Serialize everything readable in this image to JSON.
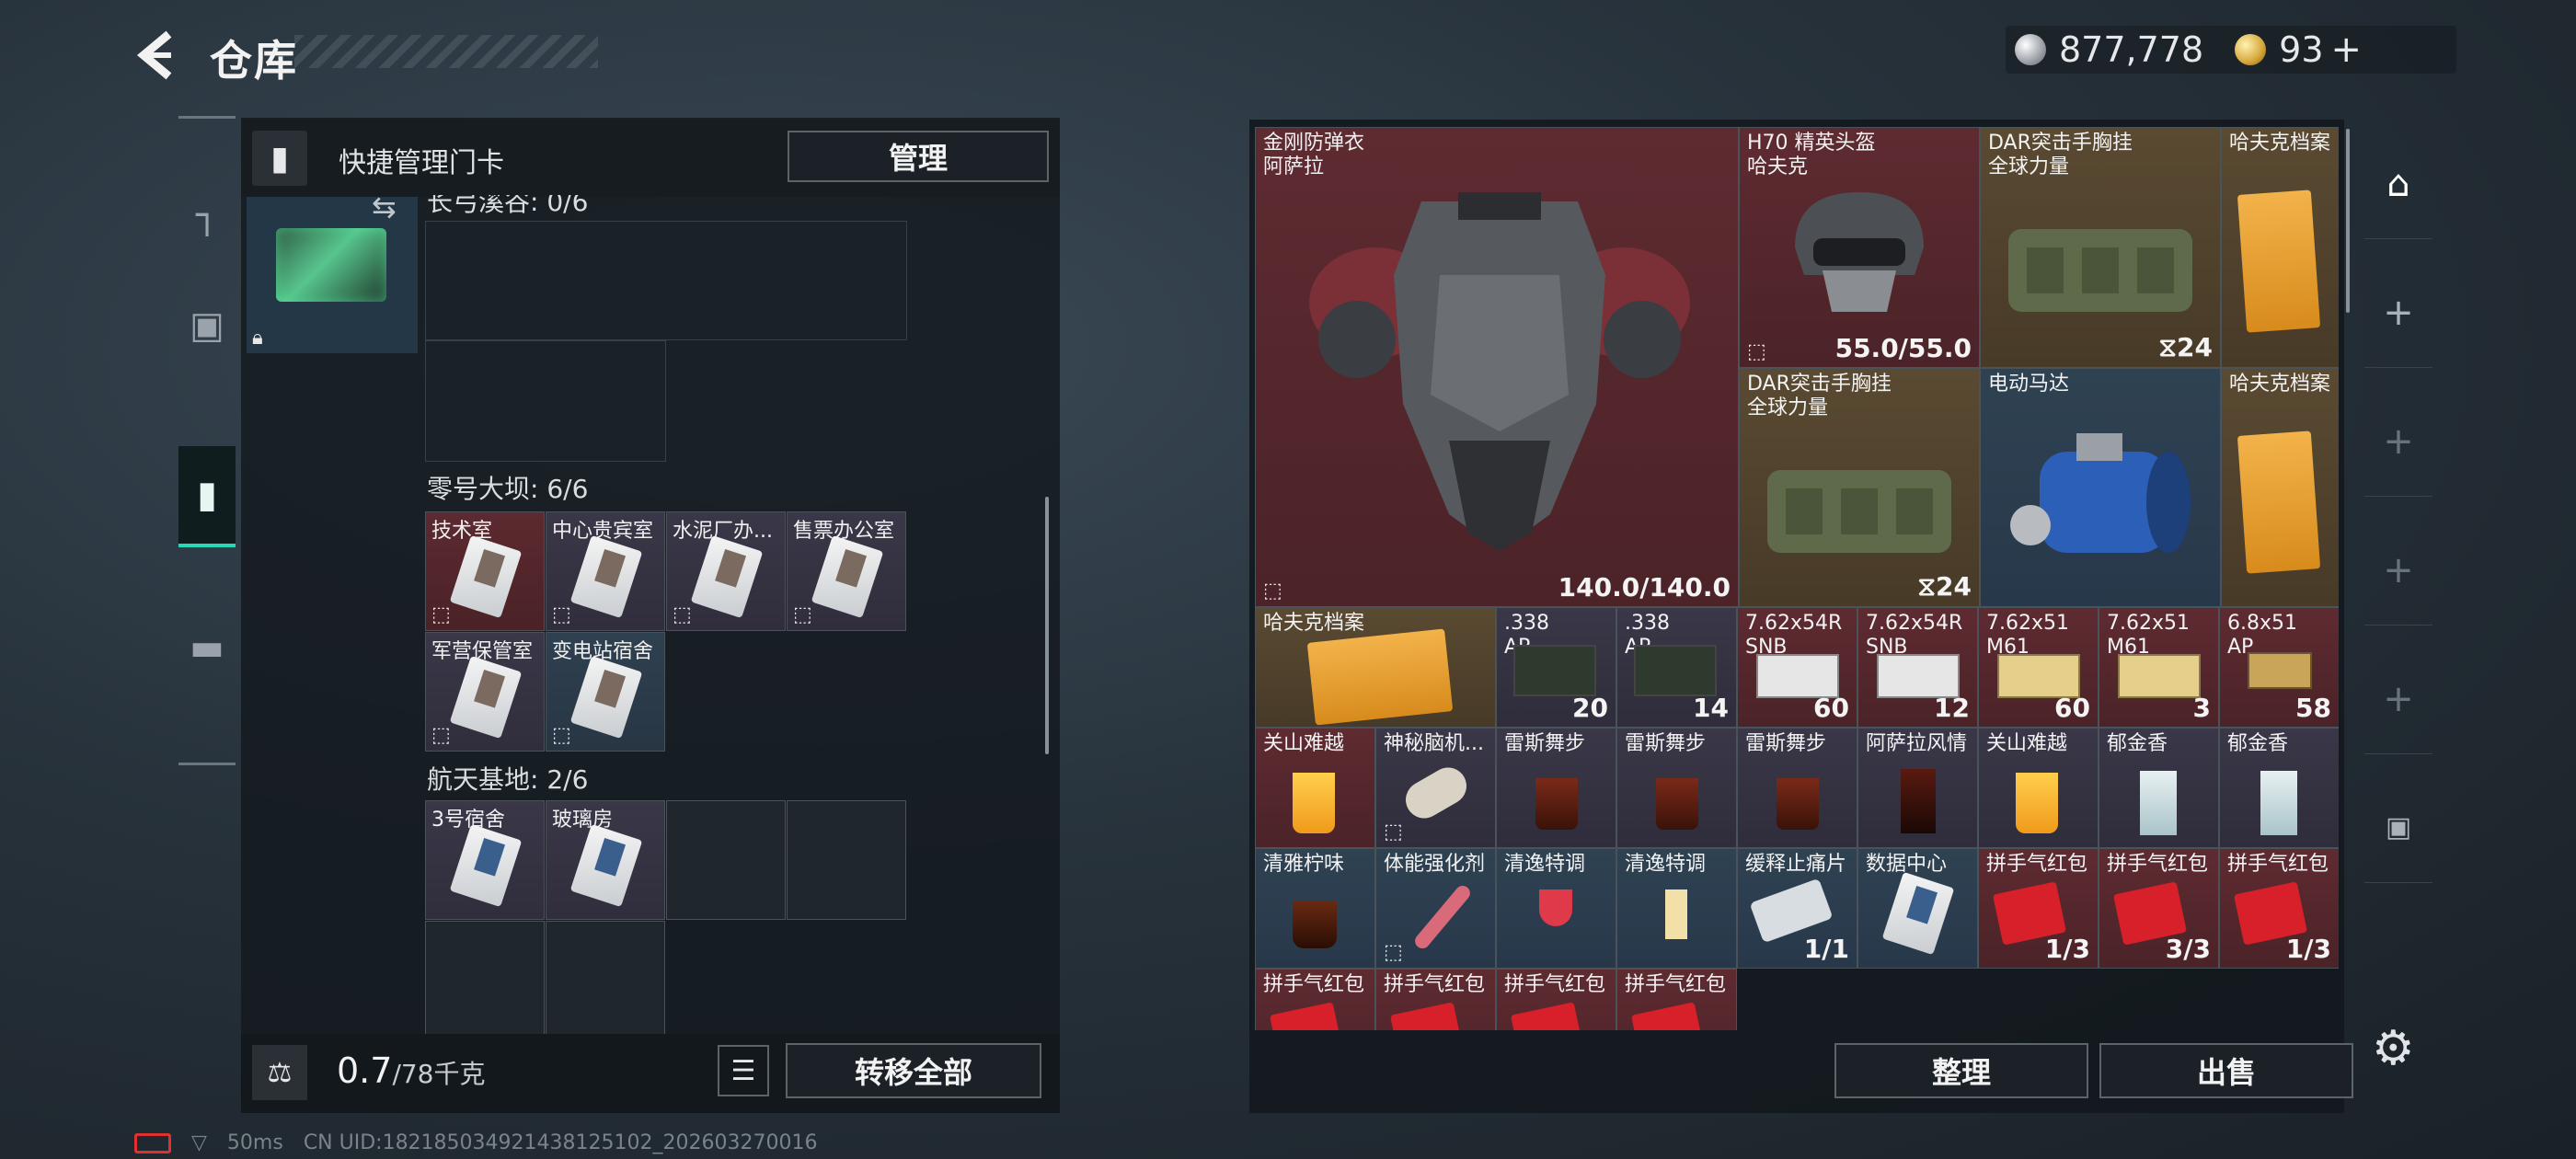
{
  "header": {
    "title": "仓库"
  },
  "currency": {
    "silver": "877,778",
    "gold": "93",
    "gold_plus": "+"
  },
  "left_nav": {
    "items": [
      "weapon",
      "armor",
      "keycard",
      "case"
    ],
    "active": "keycard"
  },
  "keycard_panel": {
    "title": "快捷管理门卡",
    "manage_label": "管理",
    "sections": [
      {
        "name": "长弓溪谷: 0/6",
        "cards": []
      },
      {
        "name": "零号大坝: 6/6",
        "cards": [
          "技术室",
          "中心贵宾室",
          "水泥厂办...",
          "售票办公室",
          "军营保管室",
          "变电站宿舍"
        ]
      },
      {
        "name": "航天基地: 2/6",
        "cards": [
          "3号宿舍",
          "玻璃房"
        ]
      }
    ]
  },
  "weight": {
    "value": "0.7",
    "capacity": "/78千克"
  },
  "transfer_label": "转移全部",
  "inventory": {
    "items": [
      {
        "name": "金刚防弹衣\n阿萨拉",
        "qty": "140.0/140.0"
      },
      {
        "name": "H70 精英头盔\n哈夫克",
        "qty": "55.0/55.0"
      },
      {
        "name": "DAR突击手胸挂\n全球力量",
        "qty": "24"
      },
      {
        "name": "哈夫克档案",
        "qty": ""
      },
      {
        "name": "DAR突击手胸挂\n全球力量",
        "qty": "24"
      },
      {
        "name": "电动马达",
        "qty": ""
      },
      {
        "name": "哈夫克档案",
        "qty": ""
      },
      {
        "name": "哈夫克档案",
        "qty": ""
      },
      {
        "name": ".338\nAP",
        "qty": "20"
      },
      {
        "name": ".338\nAP",
        "qty": "14"
      },
      {
        "name": "7.62x54R\nSNB",
        "qty": "60"
      },
      {
        "name": "7.62x54R\nSNB",
        "qty": "12"
      },
      {
        "name": "7.62x51\nM61",
        "qty": "60"
      },
      {
        "name": "7.62x51\nM61",
        "qty": "3"
      },
      {
        "name": "6.8x51\nAP",
        "qty": "58"
      },
      {
        "name": "关山难越",
        "qty": ""
      },
      {
        "name": "神秘脑机...",
        "qty": ""
      },
      {
        "name": "雷斯舞步",
        "qty": ""
      },
      {
        "name": "雷斯舞步",
        "qty": ""
      },
      {
        "name": "雷斯舞步",
        "qty": ""
      },
      {
        "name": "阿萨拉风情",
        "qty": ""
      },
      {
        "name": "关山难越",
        "qty": ""
      },
      {
        "name": "郁金香",
        "qty": ""
      },
      {
        "name": "郁金香",
        "qty": ""
      },
      {
        "name": "清雅柠味",
        "qty": ""
      },
      {
        "name": "体能强化剂",
        "qty": ""
      },
      {
        "name": "清逸特调",
        "qty": ""
      },
      {
        "name": "清逸特调",
        "qty": ""
      },
      {
        "name": "缓释止痛片",
        "qty": "1/1"
      },
      {
        "name": "数据中心",
        "qty": ""
      },
      {
        "name": "拼手气红包",
        "qty": "1/3"
      },
      {
        "name": "拼手气红包",
        "qty": "3/3"
      },
      {
        "name": "拼手气红包",
        "qty": "1/3"
      },
      {
        "name": "拼手气红包",
        "qty": ""
      },
      {
        "name": "拼手气红包",
        "qty": ""
      },
      {
        "name": "拼手气红包",
        "qty": ""
      },
      {
        "name": "拼手气红包",
        "qty": ""
      }
    ]
  },
  "actions": {
    "sort": "整理",
    "sell": "出售"
  },
  "status": {
    "ping": "50ms",
    "uid": "CN UID:18218503492143812510​2_202603270016"
  },
  "colors": {
    "accent": "#28d7b4",
    "rarity_red": "#5e2b31",
    "rarity_gold": "#5a4a32",
    "rarity_purple": "#3a3748",
    "rarity_blue": "#2f4252"
  }
}
